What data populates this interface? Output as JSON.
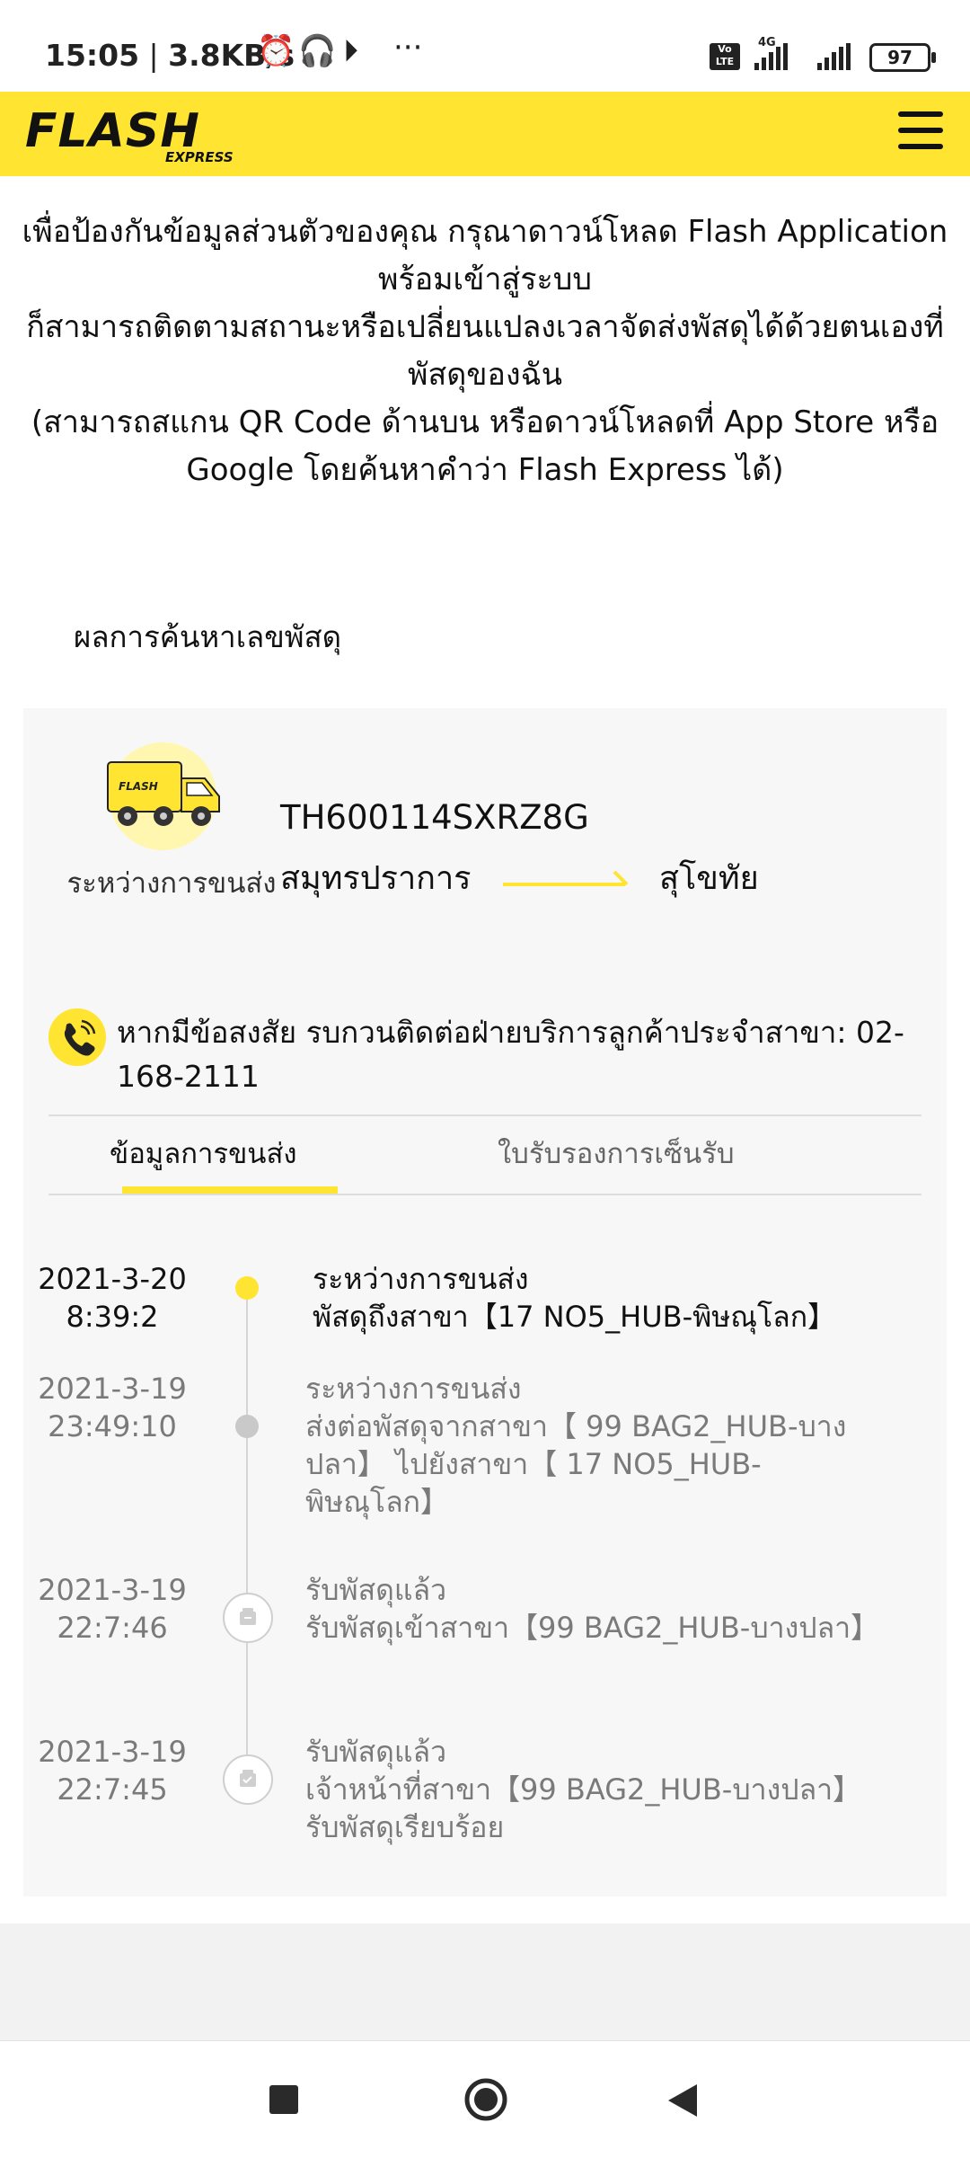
{
  "status_bar": {
    "time": "15:05",
    "speed": "3.8KB/s",
    "icons_left": [
      "alarm-icon",
      "headphones-icon",
      "play-icon",
      "more-icon"
    ],
    "network_label": "4G",
    "volte_label": "Vo LTE",
    "battery": "97"
  },
  "header": {
    "logo_text": "FLASH",
    "logo_sub": "EXPRESS",
    "brand_color": "#ffe531",
    "menu_icon": "hamburger-icon"
  },
  "notice": {
    "line1": "เพื่อป้องกันข้อมูลส่วนตัวของคุณ กรุณาดาวน์โหลด Flash Application พร้อมเข้าสู่ระบบ",
    "line2": "ก็สามารถติดตามสถานะหรือเปลี่ยนแปลงเวลาจัดส่งพัสดุได้ด้วยตนเองที่พัสดุของฉัน",
    "line3": "(สามารถสแกน QR Code ด้านบน หรือดาวน์โหลดที่ App Store หรือ Google โดยค้นหาคำว่า Flash Express ได้)"
  },
  "results_label": "ผลการค้นหาเลขพัสดุ",
  "parcel": {
    "status_icon": "delivery-truck-icon",
    "status": "ระหว่างการขนส่ง",
    "tracking_number": "TH600114SXRZ8G",
    "origin": "สมุทรปราการ",
    "destination": "สุโขทัย"
  },
  "contact": {
    "icon": "phone-icon",
    "text": "หากมีข้อสงสัย รบกวนติดต่อฝ่ายบริการลูกค้าประจำสาขา: 02-168-2111"
  },
  "tabs": [
    {
      "label": "ข้อมูลการขนส่ง",
      "active": true
    },
    {
      "label": "ใบรับรองการเซ็นรับ",
      "active": false
    }
  ],
  "timeline": [
    {
      "date": "2021-3-20",
      "time": "8:39:2",
      "title": "ระหว่างการขนส่ง",
      "detail": "พัสดุถึงสาขา【17 NO5_HUB-พิษณุโลก】"
    },
    {
      "date": "2021-3-19",
      "time": "23:49:10",
      "title": "ระหว่างการขนส่ง",
      "detail": "ส่งต่อพัสดุจากสาขา【 99 BAG2_HUB-บางปลา】 ไปยังสาขา【 17 NO5_HUB-พิษณุโลก】"
    },
    {
      "date": "2021-3-19",
      "time": "22:7:46",
      "title": "รับพัสดุแล้ว",
      "detail": "รับพัสดุเข้าสาขา【99 BAG2_HUB-บางปลา】"
    },
    {
      "date": "2021-3-19",
      "time": "22:7:45",
      "title": "รับพัสดุแล้ว",
      "detail": "เจ้าหน้าที่สาขา【99 BAG2_HUB-บางปลา】รับพัสดุเรียบร้อย"
    }
  ],
  "nav": {
    "recent": "recent-apps-icon",
    "home": "home-icon",
    "back": "back-icon"
  }
}
